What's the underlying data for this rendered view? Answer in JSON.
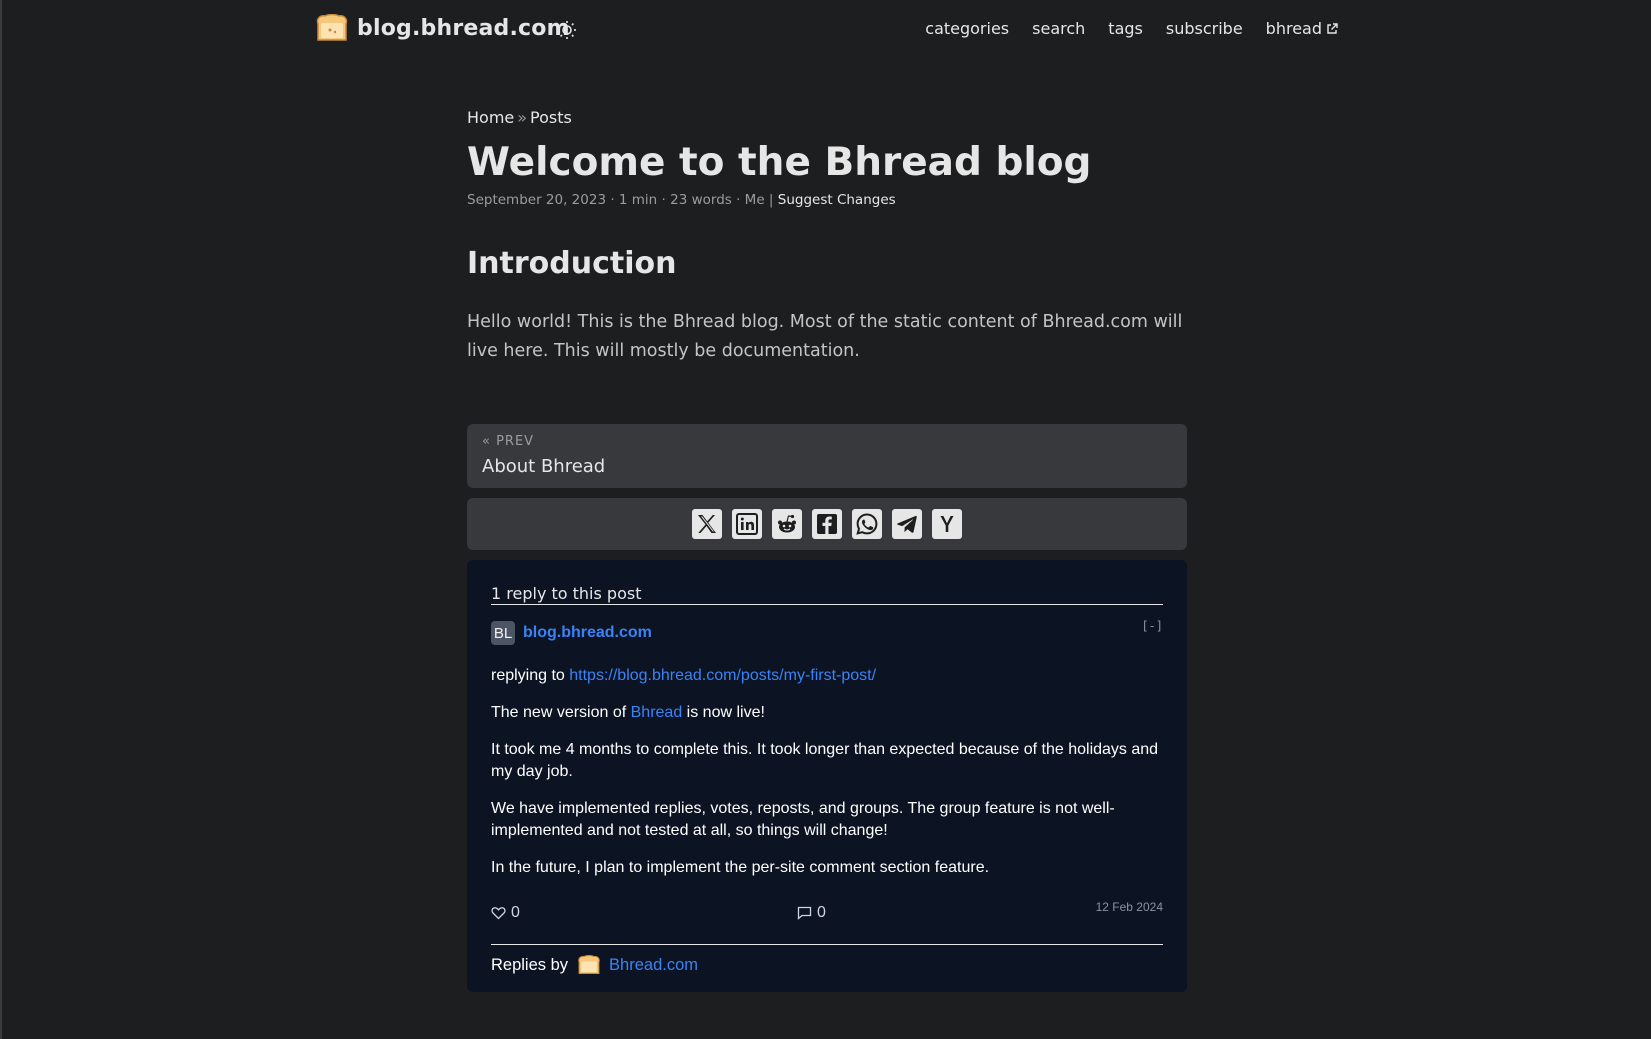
{
  "header": {
    "site_name": "blog.bhread.com",
    "nav": [
      "categories",
      "search",
      "tags",
      "subscribe",
      "bhread"
    ]
  },
  "breadcrumb": {
    "home": "Home",
    "sep": "»",
    "posts": "Posts"
  },
  "post": {
    "title": "Welcome to the Bhread blog",
    "meta": "September 20, 2023 · 1 min · 23 words · Me | ",
    "suggest": "Suggest Changes",
    "heading": "Introduction",
    "body": "Hello world! This is the Bhread blog. Most of the static content of Bhread.com will live here. This will mostly be documentation."
  },
  "paginav": {
    "label": "« PREV",
    "title": "About Bhread"
  },
  "share_icons": [
    "x-icon",
    "linkedin-icon",
    "reddit-icon",
    "facebook-icon",
    "whatsapp-icon",
    "telegram-icon",
    "ycombinator-icon"
  ],
  "comments": {
    "header": "1 reply to this post",
    "avatar": "BL",
    "author": "blog.bhread.com",
    "collapse": "[-]",
    "reply_prefix": "replying to ",
    "reply_url": "https://blog.bhread.com/posts/my-first-post/",
    "p1_a": "The new version of ",
    "p1_link": "Bhread",
    "p1_b": " is now live!",
    "p2": "It took me 4 months to complete this. It took longer than expected because of the holidays and my day job.",
    "p3": "We have implemented replies, votes, reposts, and groups. The group feature is not well-implemented and not tested at all, so things will change!",
    "p4": "In the future, I plan to implement the per-site comment section feature.",
    "likes": "0",
    "replies": "0",
    "date": "12 Feb 2024",
    "footer_prefix": "Replies by",
    "footer_link": "Bhread.com"
  },
  "colors": {
    "background": "#1d1e20",
    "card": "#38393d",
    "comments_bg": "#0c1424",
    "link": "#3b82f6"
  }
}
